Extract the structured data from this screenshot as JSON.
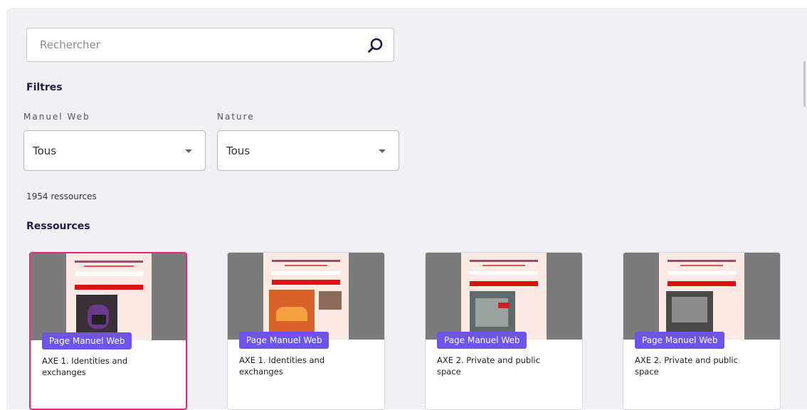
{
  "search": {
    "placeholder": "Rechercher"
  },
  "filters": {
    "title": "Filtres",
    "manuel_web": {
      "label": "Manuel Web",
      "value": "Tous"
    },
    "nature": {
      "label": "Nature",
      "value": "Tous"
    }
  },
  "results_count": "1954 ressources",
  "resources": {
    "title": "Ressources",
    "cards": [
      {
        "tag": "Page Manuel Web",
        "title": "AXE 1. Identities and exchanges",
        "selected": true
      },
      {
        "tag": "Page Manuel Web",
        "title": "AXE 1. Identities and exchanges",
        "selected": false
      },
      {
        "tag": "Page Manuel Web",
        "title": "AXE 2. Private and public space",
        "selected": false
      },
      {
        "tag": "Page Manuel Web",
        "title": "AXE 2. Private and public space",
        "selected": false
      }
    ]
  },
  "colors": {
    "accent": "#6e53ee",
    "selected_border": "#e0287a",
    "heading": "#1c1d4a"
  },
  "icons": {
    "search": "search-icon",
    "dropdown": "chevron-down-icon"
  }
}
